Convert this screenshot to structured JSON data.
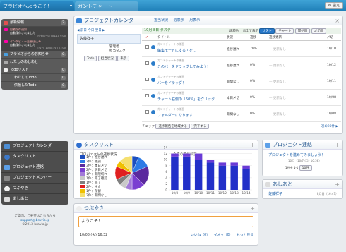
{
  "tabs": [
    {
      "label": "ブラビオへようこそ！"
    },
    {
      "label": "ガントチャート"
    }
  ],
  "settings_label": "設定",
  "sidebar": {
    "latest": {
      "label": "最新情報",
      "count": "2"
    },
    "notices": [
      {
        "title": "自動保存通知",
        "desc": "自動保存されました",
        "date": "[今後の予定] 01/10 9:00"
      },
      {
        "title": "インタビュー企画仕込み",
        "desc": "自動保存されました",
        "date": "[今日] 10/08 (火) 07:00"
      }
    ],
    "bravio_notice": {
      "label": "ブラビオからのお知らせ",
      "count": "0"
    },
    "aisatsu": {
      "label": "わたしのあしあと"
    },
    "todo": {
      "label": "Todoリスト",
      "count": "0"
    },
    "my_todo": {
      "label": "わたしのTodo",
      "count": "0"
    },
    "req_todo": {
      "label": "依頼したTodo",
      "count": "0"
    },
    "menu": [
      {
        "label": "プロジェクトカレンダー",
        "icon": "calendar-icon"
      },
      {
        "label": "タスクリスト",
        "icon": "arrow-icon"
      },
      {
        "label": "プロジェクト連絡",
        "icon": "mail-icon"
      },
      {
        "label": "プロジェクトメンバー",
        "icon": "people-icon"
      },
      {
        "label": "つぶやき",
        "icon": "chat-icon"
      },
      {
        "label": "あしあと",
        "icon": "foot-icon"
      }
    ],
    "footer": {
      "line1": "ご質問、ご要望はこちらから",
      "link": "support@bravio.jp",
      "copy": "©2013 bravio.jp"
    }
  },
  "calendar": {
    "title": "プロジェクトカレンダー",
    "tabs": [
      "担当状況",
      "週表示",
      "月表示"
    ],
    "nav": "◀ 前日  今日  翌日 ▶",
    "date": "10月 8日 火",
    "person": "佐藤祥子",
    "manager": "管理者",
    "role": "担当タスク",
    "todo_label": "Todo",
    "view_buttons": [
      "担当状況",
      "表示"
    ],
    "task_header": "10月 8日 タスク",
    "controls": {
      "reload": "再読込",
      "all": "全て表示",
      "list": "リスト",
      "chart": "チャート",
      "start": "開始日",
      "deadline": "〆切日"
    },
    "columns": {
      "title": "タイトル",
      "status": "状況",
      "progress": "進捗",
      "updated": "進捗更新",
      "deadline": "〆切"
    },
    "rows": [
      {
        "project": "ガントチャートの練習",
        "title": "編集モードにする・を...",
        "status": "進捗遅れ",
        "progress": "70%",
        "updated": "— 更新なし",
        "deadline": "10/10"
      },
      {
        "project": "ガントチャートの練習",
        "title": "このバーをドラッグしてみよう！",
        "status": "進捗遅れ",
        "progress": "0%",
        "updated": "— 更新なし",
        "deadline": "10/12"
      },
      {
        "project": "ガントチャートの練習",
        "title": "バーをドラッグ！",
        "status": "期間なし",
        "progress": "0%",
        "updated": "— 更新なし",
        "deadline": "10/11"
      },
      {
        "project": "ガントチャートの練習",
        "title": "チャート右側の「50%」をクリック...",
        "status": "本日〆切",
        "progress": "0%",
        "updated": "— 更新なし",
        "deadline": "10/08"
      },
      {
        "project": "ガントチャートの練習",
        "title": "フォルダーになります",
        "status": "期間なし",
        "progress": "0%",
        "updated": "— 更新なし",
        "deadline": "10/08"
      }
    ],
    "footer": {
      "check": "チェック",
      "btn1": "進捗報告を地域する",
      "btn2": "完了する",
      "next": "次の20件 ▶"
    }
  },
  "tasklist": {
    "title": "タスクリスト",
    "pie_title": "プロジェクトの進捗状況",
    "bar_title": "今週の進捗状況",
    "legend": [
      {
        "label": "1件：進捗遅れ",
        "color": "#1d4fbf"
      },
      {
        "label": "2件：順調",
        "color": "#2d7be6"
      },
      {
        "label": "3件：本日〆切",
        "color": "#5b2a9e"
      },
      {
        "label": "2件：明日〆切",
        "color": "#7a3fd1"
      },
      {
        "label": "1件：期限切れ",
        "color": "#a27ad8"
      },
      {
        "label": "1件：完了確認",
        "color": "#c9c9c9"
      },
      {
        "label": "1件：完了",
        "color": "#808080"
      },
      {
        "label": "2件：中止",
        "color": "#e02020"
      },
      {
        "label": "1件：保留",
        "color": "#f0c000"
      },
      {
        "label": "2件：期間なし",
        "color": "#f5e070"
      }
    ]
  },
  "chart_data": {
    "type": "bar",
    "categories": [
      "10/8",
      "10/9",
      "10/10",
      "10/11",
      "10/12",
      "10/13",
      "10/14"
    ],
    "ylim": [
      0,
      14
    ],
    "yticks": [
      "14",
      "12",
      "10",
      "8",
      "6",
      "4",
      "2",
      "0"
    ],
    "series": [
      {
        "values": [
          11,
          11,
          10,
          9,
          8,
          8,
          7
        ]
      },
      {
        "values": [
          1,
          1,
          2,
          1,
          1,
          1,
          1
        ]
      }
    ]
  },
  "contact": {
    "title": "プロジェクト連絡",
    "link": "プロジェクトを進めてみましょう！",
    "meta": "10月（10/7 (月) 10:58）",
    "pager": "1件中 1-1",
    "per_page": "10件"
  },
  "ashiato": {
    "title": "あしあと",
    "person": "佐藤祥子",
    "time": "8月前（16:47）"
  },
  "tweet": {
    "title": "つぶやき",
    "message": "ようこそ！",
    "datetime": "10/08 (火) 16:32",
    "like": "いいね（0）",
    "dislike": "ダメッ（0）",
    "more": "もっと見る"
  }
}
